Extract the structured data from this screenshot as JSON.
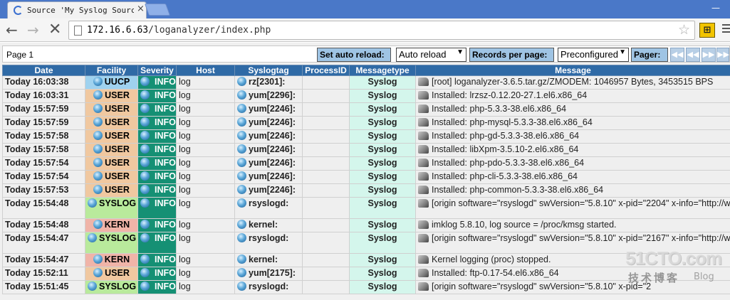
{
  "browser": {
    "tab_title": "Source 'My Syslog Source'",
    "tab_close": "×",
    "url_host": "172.16.6.63",
    "url_path": "/loganalyzer/index.php",
    "back": "←",
    "forward": "→",
    "stop": "✕",
    "star": "☆",
    "window_control": "—",
    "extension_glyph": "⊞"
  },
  "pager": {
    "page_label": "Page 1",
    "set_auto_reload_label": "Set auto reload:",
    "auto_reload_value": "Auto reload",
    "records_per_page_label": "Records per page:",
    "records_per_page_value": "Preconfigured",
    "pager_label": "Pager:",
    "buttons": [
      "◀◀",
      "◀◀",
      "▶▶",
      "▶▶"
    ]
  },
  "columns": [
    "Date",
    "Facility",
    "Severity",
    "Host",
    "Syslogtag",
    "ProcessID",
    "Messagetype",
    "Message"
  ],
  "facility_colors": {
    "UUCP": "#9fd2ef",
    "USER": "#f0c8a0",
    "SYSLOG": "#b9ea9c",
    "KERN": "#f0b4a8"
  },
  "colors": {
    "header_bg": "#2f6aa6",
    "severity_bg": "#159074",
    "messagetype_bg": "#d4f6ec",
    "cell_bg": "#efefef"
  },
  "rows": [
    {
      "date": "Today 16:03:38",
      "facility": "UUCP",
      "severity": "INFO",
      "host": "log",
      "tag": "rz[2301]:",
      "pid": "",
      "type": "Syslog",
      "message": "[root] loganalyzer-3.6.5.tar.gz/ZMODEM: 1046957 Bytes, 3453515 BPS"
    },
    {
      "date": "Today 16:03:31",
      "facility": "USER",
      "severity": "INFO",
      "host": "log",
      "tag": "yum[2296]:",
      "pid": "",
      "type": "Syslog",
      "message": "Installed: lrzsz-0.12.20-27.1.el6.x86_64"
    },
    {
      "date": "Today 15:57:59",
      "facility": "USER",
      "severity": "INFO",
      "host": "log",
      "tag": "yum[2246]:",
      "pid": "",
      "type": "Syslog",
      "message": "Installed: php-5.3.3-38.el6.x86_64"
    },
    {
      "date": "Today 15:57:59",
      "facility": "USER",
      "severity": "INFO",
      "host": "log",
      "tag": "yum[2246]:",
      "pid": "",
      "type": "Syslog",
      "message": "Installed: php-mysql-5.3.3-38.el6.x86_64"
    },
    {
      "date": "Today 15:57:58",
      "facility": "USER",
      "severity": "INFO",
      "host": "log",
      "tag": "yum[2246]:",
      "pid": "",
      "type": "Syslog",
      "message": "Installed: php-gd-5.3.3-38.el6.x86_64"
    },
    {
      "date": "Today 15:57:58",
      "facility": "USER",
      "severity": "INFO",
      "host": "log",
      "tag": "yum[2246]:",
      "pid": "",
      "type": "Syslog",
      "message": "Installed: libXpm-3.5.10-2.el6.x86_64"
    },
    {
      "date": "Today 15:57:54",
      "facility": "USER",
      "severity": "INFO",
      "host": "log",
      "tag": "yum[2246]:",
      "pid": "",
      "type": "Syslog",
      "message": "Installed: php-pdo-5.3.3-38.el6.x86_64"
    },
    {
      "date": "Today 15:57:54",
      "facility": "USER",
      "severity": "INFO",
      "host": "log",
      "tag": "yum[2246]:",
      "pid": "",
      "type": "Syslog",
      "message": "Installed: php-cli-5.3.3-38.el6.x86_64"
    },
    {
      "date": "Today 15:57:53",
      "facility": "USER",
      "severity": "INFO",
      "host": "log",
      "tag": "yum[2246]:",
      "pid": "",
      "type": "Syslog",
      "message": "Installed: php-common-5.3.3-38.el6.x86_64"
    },
    {
      "date": "Today 15:54:48",
      "facility": "SYSLOG",
      "severity": "INFO",
      "host": "log",
      "tag": "rsyslogd:",
      "pid": "",
      "type": "Syslog",
      "message": "[origin software=\"rsyslogd\" swVersion=\"5.8.10\" x-pid=\"2204\" x-info=\"http://www."
    },
    {
      "date": "Today 15:54:48",
      "facility": "KERN",
      "severity": "INFO",
      "host": "log",
      "tag": "kernel:",
      "pid": "",
      "type": "Syslog",
      "message": "imklog 5.8.10, log source = /proc/kmsg started."
    },
    {
      "date": "Today 15:54:47",
      "facility": "SYSLOG",
      "severity": "INFO",
      "host": "log",
      "tag": "rsyslogd:",
      "pid": "",
      "type": "Syslog",
      "message": "[origin software=\"rsyslogd\" swVersion=\"5.8.10\" x-pid=\"2167\" x-info=\"http://www."
    },
    {
      "date": "Today 15:54:47",
      "facility": "KERN",
      "severity": "INFO",
      "host": "log",
      "tag": "kernel:",
      "pid": "",
      "type": "Syslog",
      "message": "Kernel logging (proc) stopped."
    },
    {
      "date": "Today 15:52:11",
      "facility": "USER",
      "severity": "INFO",
      "host": "log",
      "tag": "yum[2175]:",
      "pid": "",
      "type": "Syslog",
      "message": "Installed: ftp-0.17-54.el6.x86_64"
    },
    {
      "date": "Today 15:51:45",
      "facility": "SYSLOG",
      "severity": "INFO",
      "host": "log",
      "tag": "rsyslogd:",
      "pid": "",
      "type": "Syslog",
      "message": "[origin software=\"rsyslogd\" swVersion=\"5.8.10\" x-pid=\"2"
    }
  ],
  "watermark": {
    "brand": "51CTO.com",
    "sub": "技术博客",
    "blog": "Blog"
  }
}
